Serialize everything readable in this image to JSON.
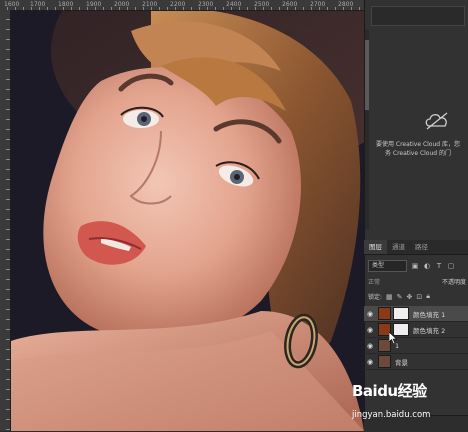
{
  "ruler": {
    "top_labels": [
      "1600",
      "1700",
      "1800",
      "1900",
      "2000",
      "2100",
      "2200",
      "2300",
      "2400",
      "2500",
      "2600",
      "2700",
      "2800"
    ]
  },
  "cloud_panel": {
    "message_line1": "要使用 Creative Cloud 库，您",
    "message_line2": "务 Creative Cloud 的门"
  },
  "layers_panel": {
    "tabs": [
      "图层",
      "通道",
      "路径"
    ],
    "filter_label": "类型",
    "blend_mode": "正常",
    "opacity_label": "不透明度",
    "lock_label": "锁定:",
    "layers": [
      {
        "name": "颜色填充 1",
        "selected": true,
        "thumb_color": "#8a3a16"
      },
      {
        "name": "颜色填充 2",
        "selected": false,
        "thumb_color": "#8a3a16"
      },
      {
        "name": "1",
        "selected": false,
        "thumb_color": "#6b4a3a"
      },
      {
        "name": "背景",
        "selected": false,
        "thumb_color": "#6b4a3a"
      }
    ]
  },
  "watermark": {
    "logo": "Baidu经验",
    "url": "jingyan.baidu.com"
  }
}
